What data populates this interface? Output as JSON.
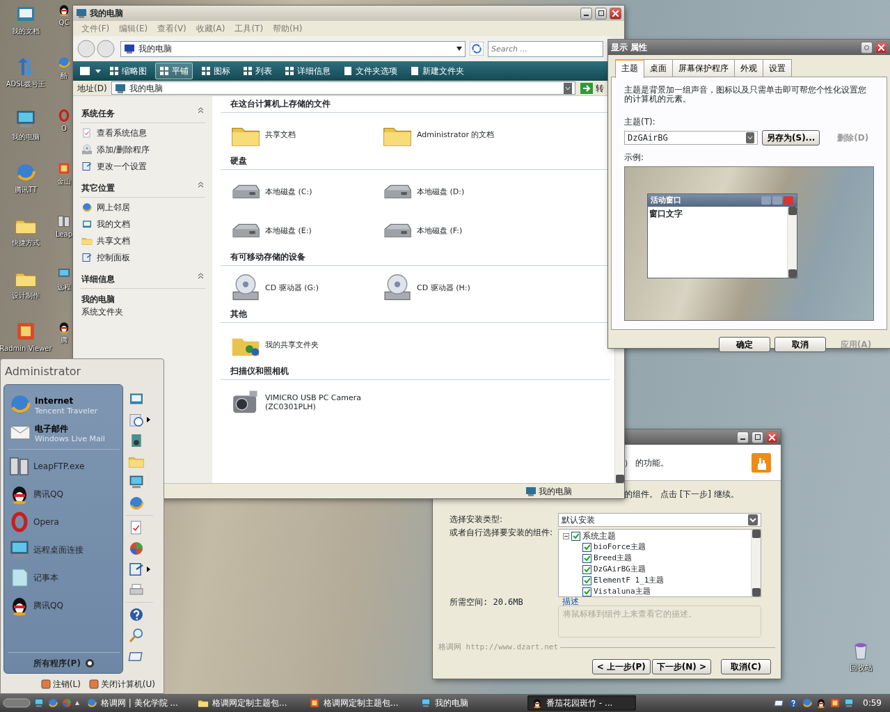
{
  "desktop_icons": [
    {
      "label": "我的文档",
      "kind": "docs"
    },
    {
      "label": "ADSL拨号王",
      "kind": "arrows"
    },
    {
      "label": "我的电脑",
      "kind": "computer"
    },
    {
      "label": "腾讯TT",
      "kind": "globe"
    },
    {
      "label": "快捷方式",
      "kind": "folder"
    },
    {
      "label": "设计制作",
      "kind": "folder"
    },
    {
      "label": "Radmin Viewer",
      "kind": "app"
    }
  ],
  "desktop_icons_partly_hidden": [
    {
      "label": "QC",
      "kind": "penguin"
    },
    {
      "label": "酷",
      "kind": "globe"
    },
    {
      "label": "O",
      "kind": "ring"
    },
    {
      "label": "金山",
      "kind": "app"
    },
    {
      "label": "Leap",
      "kind": "servers"
    },
    {
      "label": "远程",
      "kind": "computer"
    },
    {
      "label": "腾",
      "kind": "penguin"
    }
  ],
  "recycle_bin": {
    "label": "回收站"
  },
  "explorer": {
    "title": "我的电脑",
    "menu": [
      "文件(F)",
      "编辑(E)",
      "查看(V)",
      "收藏(A)",
      "工具(T)",
      "帮助(H)"
    ],
    "breadcrumb": "我的电脑",
    "search": {
      "placeholder": "Search ..."
    },
    "views": [
      {
        "label": "缩略图",
        "selected": false
      },
      {
        "label": "平铺",
        "selected": true
      },
      {
        "label": "图标",
        "selected": false
      },
      {
        "label": "列表",
        "selected": false
      },
      {
        "label": "详细信息",
        "selected": false
      }
    ],
    "actions": [
      "文件夹选项",
      "新建文件夹"
    ],
    "address": {
      "label": "地址(D)",
      "value": "我的电脑",
      "go": "转"
    },
    "sidebar": [
      {
        "title": "系统任务",
        "kind": "links",
        "items": [
          {
            "label": "查看系统信息",
            "kind": "doc"
          },
          {
            "label": "添加/删除程序",
            "kind": "cd"
          },
          {
            "label": "更改一个设置",
            "kind": "panel"
          }
        ]
      },
      {
        "title": "其它位置",
        "kind": "links",
        "items": [
          {
            "label": "网上邻居",
            "kind": "globe"
          },
          {
            "label": "我的文档",
            "kind": "docs"
          },
          {
            "label": "共享文档",
            "kind": "folder"
          },
          {
            "label": "控制面板",
            "kind": "panel"
          }
        ]
      },
      {
        "title": "详细信息",
        "kind": "details",
        "items": [
          {
            "label": "我的电脑",
            "kind": "name"
          },
          {
            "label": "系统文件夹",
            "kind": "type"
          }
        ]
      }
    ],
    "groups": [
      {
        "title": "在这台计算机上存储的文件",
        "items": [
          {
            "label": "共享文档",
            "kind": "folder"
          },
          {
            "label": "Administrator 的文档",
            "kind": "folder"
          }
        ]
      },
      {
        "title": "硬盘",
        "items": [
          {
            "label": "本地磁盘 (C:)",
            "kind": "drive"
          },
          {
            "label": "本地磁盘 (D:)",
            "kind": "drive"
          },
          {
            "label": "本地磁盘 (E:)",
            "kind": "drive"
          },
          {
            "label": "本地磁盘 (F:)",
            "kind": "drive"
          }
        ]
      },
      {
        "title": "有可移动存储的设备",
        "items": [
          {
            "label": "CD 驱动器 (G:)",
            "kind": "cd"
          },
          {
            "label": "CD 驱动器 (H:)",
            "kind": "cd"
          }
        ]
      },
      {
        "title": "其他",
        "items": [
          {
            "label": "我的共享文件夹",
            "kind": "shared"
          }
        ]
      },
      {
        "title": "扫描仪和照相机",
        "items": [
          {
            "label": "VIMICRO USB PC Camera (ZC0301PLH)",
            "kind": "camera"
          }
        ]
      }
    ],
    "status": "我的电脑"
  },
  "display": {
    "title": "显示 属性",
    "tabs": [
      {
        "label": "主题",
        "selected": true
      },
      {
        "label": "桌面",
        "selected": false
      },
      {
        "label": "屏幕保护程序",
        "selected": false
      },
      {
        "label": "外观",
        "selected": false
      },
      {
        "label": "设置",
        "selected": false
      }
    ],
    "description": "主题是背景加一组声音，图标以及只需单击即可帮您个性化设置您的计算机的元素。",
    "theme_label": "主题(T):",
    "theme_value": "DzGAirBG",
    "theme_buttons": [
      {
        "label": "另存为(S)...",
        "disabled": false
      },
      {
        "label": "删除(D)",
        "disabled": true
      }
    ],
    "example_label": "示例:",
    "preview": {
      "title": "活动窗口",
      "text": "窗口文字"
    },
    "buttons": [
      {
        "label": "确定",
        "disabled": false
      },
      {
        "label": "取消",
        "disabled": false
      },
      {
        "label": "应用(A)",
        "disabled": true
      }
    ]
  },
  "installer": {
    "header_text": "） 的功能。",
    "intro_text": "的组件。 点击 [下一步] 继续。",
    "type_label": "选择安装类型:",
    "type_value": "默认安装",
    "components_label": "或者自行选择要安装的组件:",
    "tree": [
      {
        "label": "系统主题",
        "checked": true,
        "expanded": true,
        "children": [
          {
            "label": "bioForce主题",
            "checked": true
          },
          {
            "label": "Breed主题",
            "checked": true
          },
          {
            "label": "DzGAirBG主题",
            "checked": true
          },
          {
            "label": "ElementF 1_1主题",
            "checked": true
          },
          {
            "label": "Vistaluna主题",
            "checked": true
          }
        ]
      }
    ],
    "description_title": "描述",
    "description_placeholder": "将鼠标移到组件上来查看它的描述。",
    "space": "所需空间: 20.6MB",
    "brand": "格调网 http://www.dzart.net",
    "buttons": [
      "< 上一步(P)",
      "下一步(N) >",
      "取消(C)"
    ]
  },
  "start_menu": {
    "user": "Administrator",
    "pinned": [
      {
        "title": "Internet",
        "subtitle": "Tencent Traveler",
        "kind": "globe"
      },
      {
        "title": "电子邮件",
        "subtitle": "Windows Live Mail",
        "kind": "mail"
      }
    ],
    "recent": [
      {
        "label": "LeapFTP.exe",
        "kind": "servers"
      },
      {
        "label": "腾讯QQ",
        "kind": "penguin"
      },
      {
        "label": "Opera",
        "kind": "ring"
      },
      {
        "label": "远程桌面连接",
        "kind": "computer"
      },
      {
        "label": "记事本",
        "kind": "notepad"
      },
      {
        "label": "腾讯QQ",
        "kind": "penguin"
      }
    ],
    "all_programs": "所有程序(P)",
    "places": [
      {
        "kind": "docs",
        "submenu": false
      },
      {
        "kind": "clock",
        "submenu": true
      },
      {
        "kind": "music",
        "submenu": false
      },
      {
        "kind": "folder",
        "submenu": false
      },
      {
        "kind": "computer",
        "submenu": false
      },
      {
        "kind": "globe",
        "submenu": false
      },
      {
        "kind": "doc",
        "submenu": false
      },
      {
        "kind": "shield",
        "submenu": false
      },
      {
        "kind": "panel",
        "submenu": true
      },
      {
        "kind": "printer",
        "submenu": false
      },
      {
        "kind": "help",
        "submenu": false
      },
      {
        "kind": "search",
        "submenu": false
      },
      {
        "kind": "run",
        "submenu": false
      }
    ],
    "footer": [
      "注销(L)",
      "关闭计算机(U)"
    ]
  },
  "taskbar": {
    "tasks": [
      {
        "label": "格调网 | 美化学院 ...",
        "kind": "globe",
        "selected": false
      },
      {
        "label": "格调网定制主题包...",
        "kind": "folder",
        "selected": false
      },
      {
        "label": "格调网定制主题包...",
        "kind": "app",
        "selected": false
      },
      {
        "label": "我的电脑",
        "kind": "computer",
        "selected": false
      },
      {
        "label": "番茄花园斑竹 - ...",
        "kind": "penguin",
        "selected": true
      }
    ],
    "clock": "0:59"
  }
}
